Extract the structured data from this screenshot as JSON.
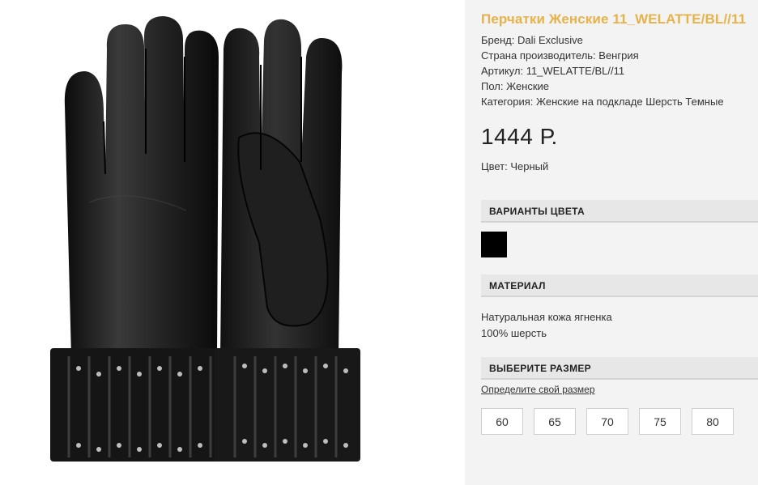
{
  "product": {
    "title": "Перчатки Женские 11_WELATTE/BL//11",
    "attributes": [
      "Бренд: Dali Exclusive",
      "Страна производитель: Венгрия",
      "Артикул: 11_WELATTE/BL//11",
      "Пол: Женские",
      "Категория: Женские на подкладе Шерсть Темные"
    ],
    "price": "1444 Р.",
    "color_line": "Цвет: Черный"
  },
  "sections": {
    "color_variants": "ВАРИАНТЫ ЦВЕТА",
    "material": "МАТЕРИАЛ",
    "size": "ВЫБЕРИТЕ РАЗМЕР"
  },
  "material_lines": [
    "Натуральная кожа ягненка",
    "100% шерсть"
  ],
  "swatch_color": "#000000",
  "size_link": "Определите свой размер",
  "sizes": [
    "60",
    "65",
    "70",
    "75",
    "80"
  ],
  "colors": {
    "accent": "#e6b24a",
    "panel": "#f3f3f3",
    "header": "#e7e7e7"
  }
}
